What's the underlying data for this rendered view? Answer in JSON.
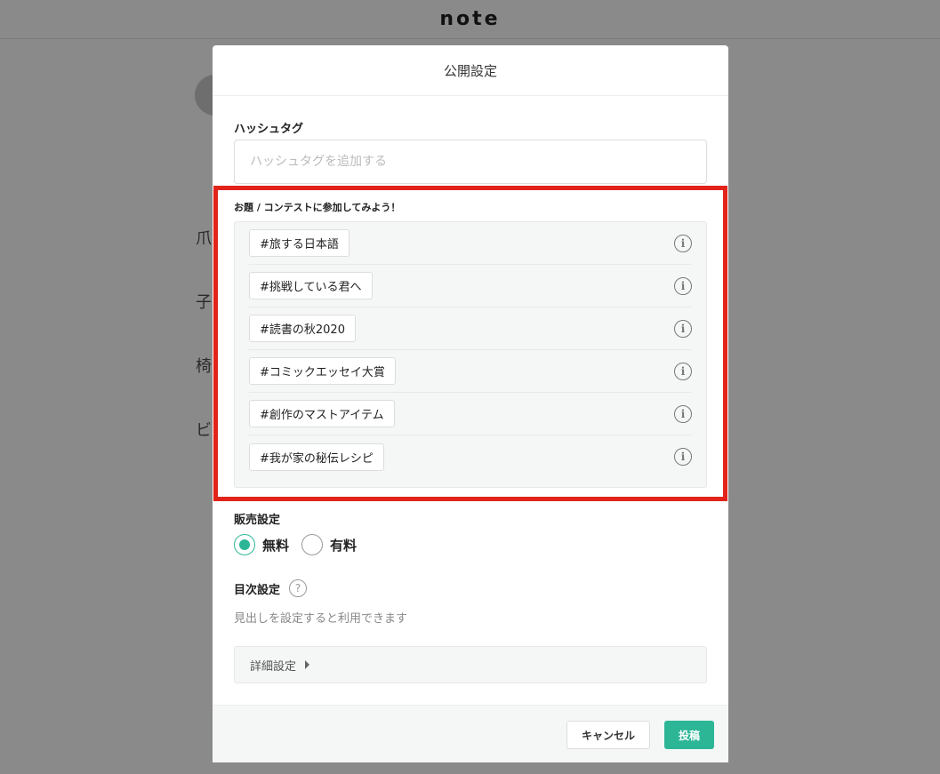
{
  "background": {
    "logo": "note",
    "lines": [
      "爪",
      "子",
      "椅",
      "ビ"
    ]
  },
  "modal": {
    "title": "公開設定",
    "hashtag": {
      "label": "ハッシュタグ",
      "placeholder": "ハッシュタグを追加する"
    },
    "contest": {
      "title": "お題 / コンテストに参加してみよう！",
      "tags": [
        "#旅する日本語",
        "#挑戦している君へ",
        "#読書の秋2020",
        "#コミックエッセイ大賞",
        "#創作のマストアイテム",
        "#我が家の秘伝レシピ"
      ]
    },
    "sales": {
      "label": "販売設定",
      "options": [
        "無料",
        "有料"
      ],
      "selected": "無料"
    },
    "toc": {
      "label": "目次設定",
      "help_icon": "?",
      "description": "見出しを設定すると利用できます"
    },
    "advanced": {
      "label": "詳細設定"
    },
    "footer": {
      "cancel_label": "キャンセル",
      "post_label": "投稿"
    }
  },
  "colors": {
    "accent": "#2cb696",
    "highlight": "#e2231a",
    "overlay": "#8a8a8a"
  }
}
